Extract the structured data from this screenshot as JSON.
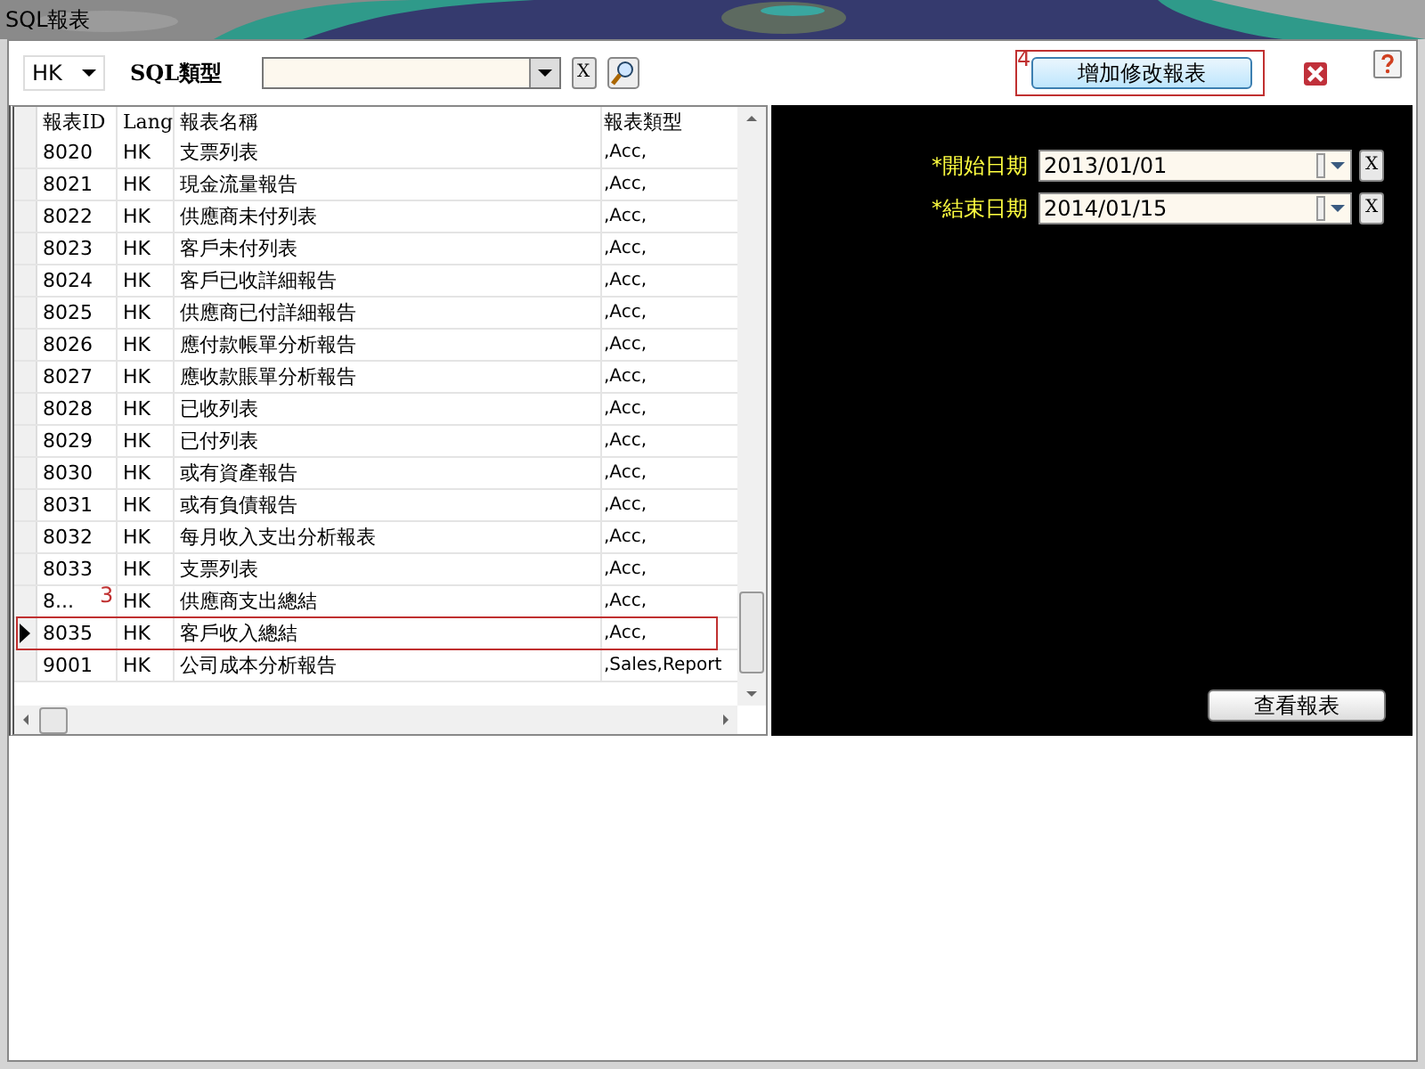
{
  "window": {
    "title": "SQL報表"
  },
  "toolbar": {
    "language": "HK",
    "sql_type_label": "SQL類型",
    "sql_type_clear": "X",
    "add_report_button": {
      "label": "增加修改報表",
      "callout": "4"
    }
  },
  "table": {
    "columns": [
      "報表ID",
      "Lang",
      "報表名稱",
      "報表類型"
    ],
    "rows": [
      {
        "id": "8020",
        "lang": "HK",
        "name": "支票列表",
        "type": ",Acc,",
        "selected": false
      },
      {
        "id": "8021",
        "lang": "HK",
        "name": "現金流量報告",
        "type": ",Acc,",
        "selected": false
      },
      {
        "id": "8022",
        "lang": "HK",
        "name": "供應商未付列表",
        "type": ",Acc,",
        "selected": false
      },
      {
        "id": "8023",
        "lang": "HK",
        "name": "客戶未付列表",
        "type": ",Acc,",
        "selected": false
      },
      {
        "id": "8024",
        "lang": "HK",
        "name": "客戶已收詳細報告",
        "type": ",Acc,",
        "selected": false
      },
      {
        "id": "8025",
        "lang": "HK",
        "name": "供應商已付詳細報告",
        "type": ",Acc,",
        "selected": false
      },
      {
        "id": "8026",
        "lang": "HK",
        "name": "應付款帳單分析報告",
        "type": ",Acc,",
        "selected": false
      },
      {
        "id": "8027",
        "lang": "HK",
        "name": "應收款賬單分析報告",
        "type": ",Acc,",
        "selected": false
      },
      {
        "id": "8028",
        "lang": "HK",
        "name": "已收列表",
        "type": ",Acc,",
        "selected": false
      },
      {
        "id": "8029",
        "lang": "HK",
        "name": "已付列表",
        "type": ",Acc,",
        "selected": false
      },
      {
        "id": "8030",
        "lang": "HK",
        "name": "或有資產報告",
        "type": ",Acc,",
        "selected": false
      },
      {
        "id": "8031",
        "lang": "HK",
        "name": "或有負債報告",
        "type": ",Acc,",
        "selected": false
      },
      {
        "id": "8032",
        "lang": "HK",
        "name": "每月收入支出分析報表",
        "type": ",Acc,",
        "selected": false
      },
      {
        "id": "8033",
        "lang": "HK",
        "name": "支票列表",
        "type": ",Acc,",
        "selected": false
      },
      {
        "id": "8...",
        "lang": "HK",
        "name": "供應商支出總結",
        "type": ",Acc,",
        "selected": false
      },
      {
        "id": "8035",
        "lang": "HK",
        "name": "客戶收入總結",
        "type": ",Acc,",
        "selected": true,
        "callout": "3"
      },
      {
        "id": "9001",
        "lang": "HK",
        "name": "公司成本分析報告",
        "type": ",Sales,Report",
        "selected": false
      }
    ]
  },
  "parameters": [
    {
      "label": "*開始日期",
      "value": "2013/01/01",
      "clear": "X"
    },
    {
      "label": "*結束日期",
      "value": "2014/01/15",
      "clear": "X"
    }
  ],
  "view_report_button": "查看報表"
}
